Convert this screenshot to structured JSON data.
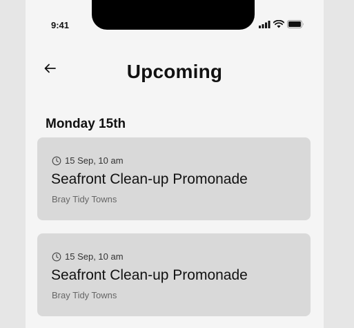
{
  "status_bar": {
    "time": "9:41",
    "icons": [
      "cellular-signal-icon",
      "wifi-icon",
      "battery-icon"
    ]
  },
  "header": {
    "back_icon": "arrow-left-icon",
    "title": "Upcoming"
  },
  "sections": [
    {
      "day": "Monday 15th",
      "events": [
        {
          "time_icon": "clock-icon",
          "time": "15 Sep, 10 am",
          "title": "Seafront Clean-up Promonade",
          "organizer": "Bray Tidy Towns"
        },
        {
          "time_icon": "clock-icon",
          "time": "15 Sep, 10 am",
          "title": "Seafront Clean-up Promonade",
          "organizer": "Bray Tidy Towns"
        }
      ]
    }
  ],
  "colors": {
    "background": "#e6e6e6",
    "screen": "#f5f5f5",
    "card": "#d9d9d9",
    "text": "#111111",
    "muted": "#666666"
  }
}
